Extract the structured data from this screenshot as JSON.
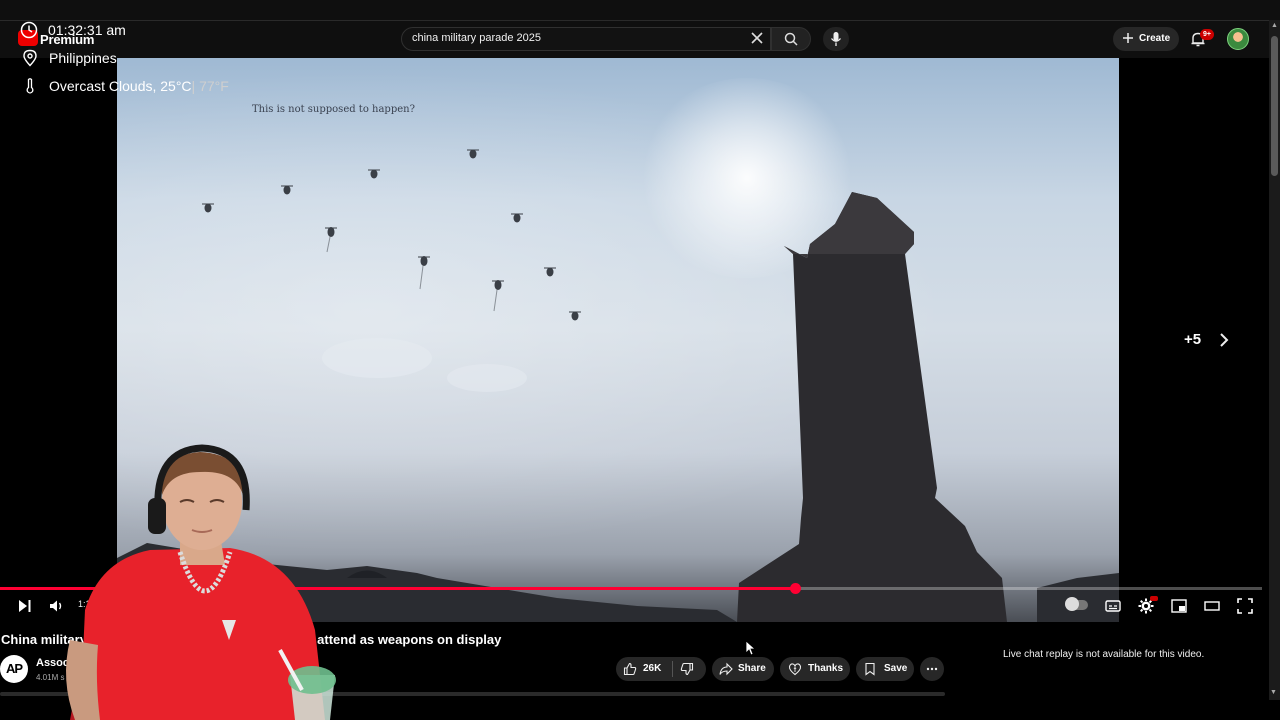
{
  "header": {
    "logo_label": "Premium",
    "search_query": "china military parade 2025",
    "create_label": "Create",
    "notifications_badge": "9+"
  },
  "overlay": {
    "time": "01:32:31 am",
    "location": "Philippines",
    "weather": "Overcast Clouds, 25°C",
    "weather_f": " | 77°F"
  },
  "video": {
    "caption": "This is not supposed to happen?",
    "more_count": "+5",
    "time_display": "1:16:09 / 1",
    "progress_fraction": 0.63
  },
  "info": {
    "title": "China military parade: Putin, Kim Jong Un attend as weapons on display",
    "title_visible_start": "China military ",
    "title_visible_end": "n attend as weapons on display",
    "channel_name": "Associat",
    "subscribers": "4.01M s",
    "logo_text": "AP",
    "likes": "26K",
    "share_label": "Share",
    "thanks_label": "Thanks",
    "save_label": "Save"
  },
  "chat": {
    "message": "Live chat replay is not available for this video."
  },
  "colors": {
    "accent": "#ff0033",
    "background": "#0f0f0f",
    "pill": "#272727",
    "streamer_shirt": "#e8222b"
  }
}
